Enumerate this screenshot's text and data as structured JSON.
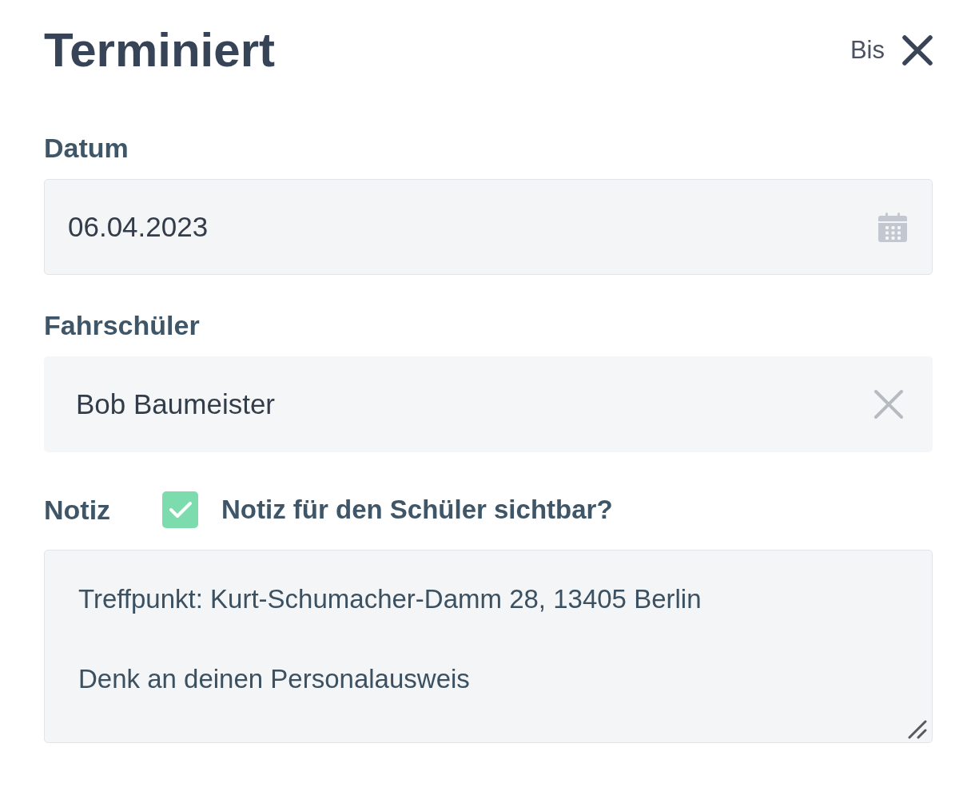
{
  "dialog": {
    "title": "Terminiert",
    "until_label": "Bis"
  },
  "fields": [
    {
      "kind": "date",
      "label": "Datum",
      "value": "06.04.2023"
    },
    {
      "kind": "select",
      "label": "Fahrschüler",
      "value": "Bob Baumeister"
    }
  ],
  "note": {
    "label": "Notiz",
    "visibility": {
      "label": "Notiz für den Schüler sichtbar?",
      "checked": true
    },
    "value": "Treffpunkt: Kurt-Schumacher-Damm 28, 13405 Berlin\n\nDenk an deinen Personalausweis"
  }
}
